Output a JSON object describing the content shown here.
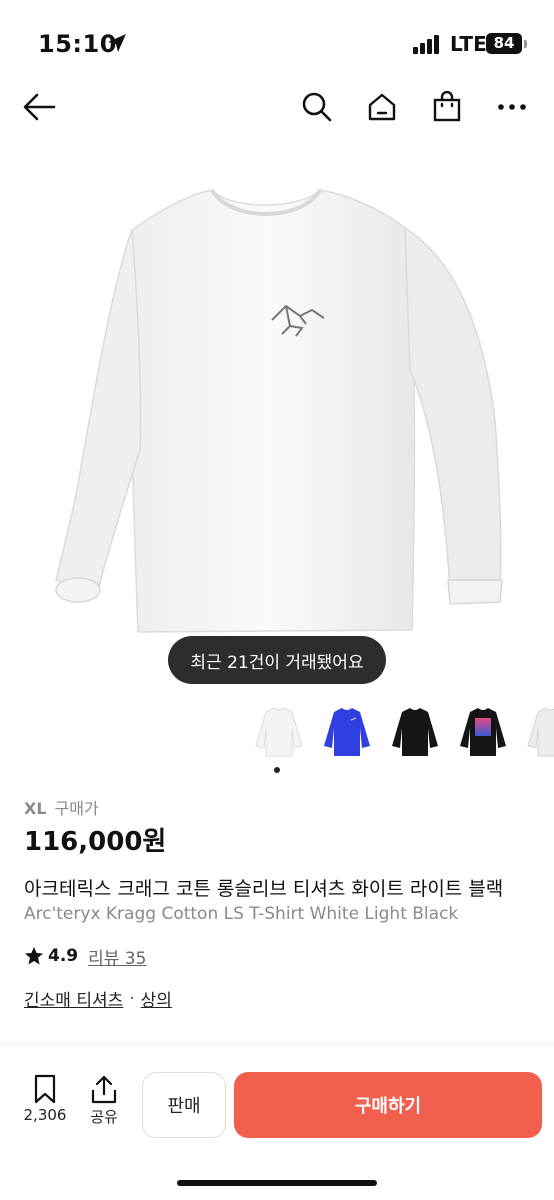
{
  "status": {
    "time": "15:10",
    "network": "LTE",
    "battery": "84"
  },
  "toast": {
    "text": "최근 21건이 거래됐어요"
  },
  "thumbnails": [
    {
      "color": "#f4f4f4",
      "name": "white"
    },
    {
      "color": "#2f3fe0",
      "name": "blue"
    },
    {
      "color": "#151515",
      "name": "black"
    },
    {
      "color": "#151515",
      "name": "black-graphic"
    },
    {
      "color": "#ececec",
      "name": "light"
    }
  ],
  "product": {
    "size": "XL",
    "price_type": "구매가",
    "price": "116,000원",
    "title_ko": "아크테릭스 크래그 코튼 롱슬리브 티셔츠 화이트 라이트 블랙",
    "title_en": "Arc'teryx Kragg Cotton LS T-Shirt White Light Black",
    "rating": "4.9",
    "review_label": "리뷰 35",
    "category": "긴소매 티셔츠",
    "category_separator": "·",
    "subcategory": "상의"
  },
  "bottom": {
    "bookmark_count": "2,306",
    "share_label": "공유",
    "sell_label": "판매",
    "buy_label": "구매하기"
  },
  "colors": {
    "accent": "#f0604d",
    "toast_bg": "#2d2d2d"
  }
}
